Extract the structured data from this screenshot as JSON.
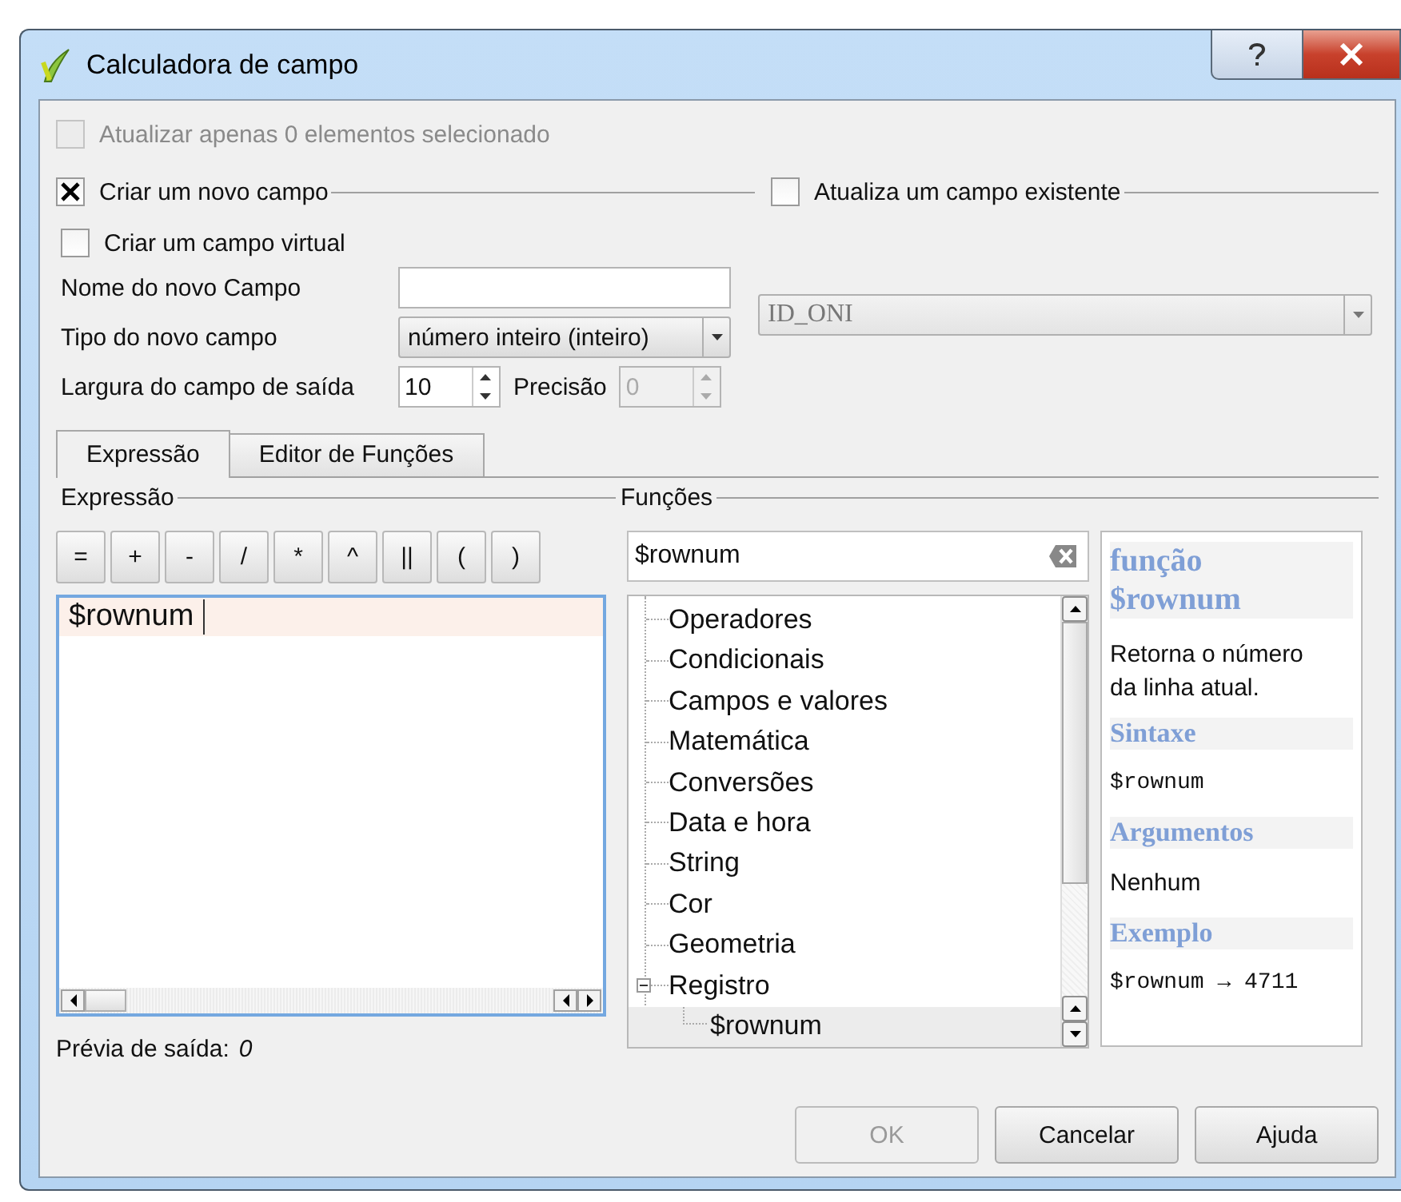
{
  "window": {
    "title": "Calculadora de campo"
  },
  "update_selected": {
    "label": "Atualizar apenas 0 elementos selecionado",
    "checked": false,
    "disabled": true
  },
  "create_new": {
    "label": "Criar um novo campo",
    "checked": true
  },
  "update_existing": {
    "label": "Atualiza um campo existente",
    "checked": false
  },
  "virtual": {
    "label": "Criar um campo virtual",
    "checked": false
  },
  "new_field": {
    "name_label": "Nome do novo Campo",
    "type_label": "Tipo do novo campo",
    "type_value": "número inteiro (inteiro)",
    "width_label": "Largura do campo de saída",
    "width_value": "10",
    "precision_label": "Precisão",
    "precision_value": "0",
    "precision_disabled": true
  },
  "existing_field": {
    "value": "ID_ONI",
    "disabled": true
  },
  "tabs": [
    {
      "label": "Expressão",
      "selected": true
    },
    {
      "label": "Editor de Funções",
      "selected": false
    }
  ],
  "expression": {
    "heading": "Expressão",
    "operators": [
      "=",
      "+",
      "-",
      "/",
      "*",
      "^",
      "||",
      "(",
      ")"
    ],
    "text": "$rownum",
    "preview_label": "Prévia de saída:",
    "preview_value": "0"
  },
  "functions": {
    "heading": "Funções",
    "search": "$rownum",
    "tree": [
      {
        "label": "Operadores",
        "selected": false
      },
      {
        "label": "Condicionais",
        "selected": false
      },
      {
        "label": "Campos e valores",
        "selected": false
      },
      {
        "label": "Matemática",
        "selected": false
      },
      {
        "label": "Conversões",
        "selected": false
      },
      {
        "label": "Data e hora",
        "selected": false
      },
      {
        "label": "String",
        "selected": false
      },
      {
        "label": "Cor",
        "selected": false
      },
      {
        "label": "Geometria",
        "selected": false
      },
      {
        "label": "Registro",
        "selected": false,
        "expanded": true,
        "children": [
          {
            "label": "$rownum",
            "selected": true
          }
        ]
      }
    ]
  },
  "help": {
    "title": "função $rownum",
    "description": "Retorna o número da linha atual.",
    "sections": [
      {
        "heading": "Sintaxe",
        "body": "$rownum",
        "kind": "code"
      },
      {
        "heading": "Argumentos",
        "body": "Nenhum",
        "kind": "text"
      },
      {
        "heading": "Exemplo",
        "body": "$rownum → 4711",
        "kind": "code"
      }
    ]
  },
  "buttons": [
    {
      "label": "OK",
      "disabled": true
    },
    {
      "label": "Cancelar",
      "disabled": false
    },
    {
      "label": "Ajuda",
      "disabled": false
    }
  ]
}
